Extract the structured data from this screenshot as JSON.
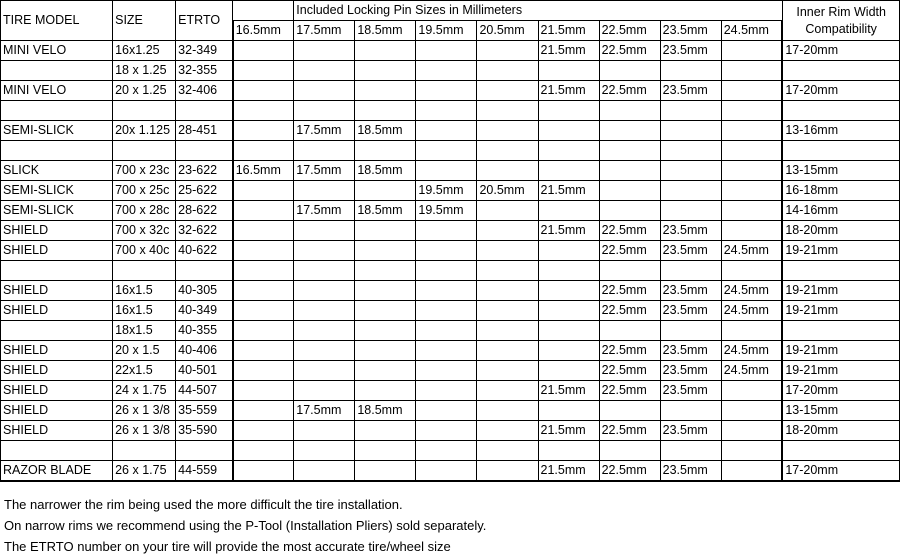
{
  "header": {
    "col_model": "TIRE MODEL",
    "col_size": "SIZE",
    "col_etrto": "ETRTO",
    "pin_group_title": "Included Locking Pin Sizes in Millimeters",
    "rim_title_line1": "Inner Rim Width",
    "rim_title_line2": "Compatibility",
    "pins": [
      {
        "label": "16.5mm",
        "color": "#ff0000",
        "class": "pc-red"
      },
      {
        "label": "17.5mm",
        "color": "#ffbf00",
        "class": "pc-orange"
      },
      {
        "label": "18.5mm",
        "color": "#ffff00",
        "class": "pc-yellow"
      },
      {
        "label": "19.5mm",
        "color": "#00b0f0",
        "class": "pc-ltblue"
      },
      {
        "label": "20.5mm",
        "color": "#92d050",
        "class": "pc-green"
      },
      {
        "label": "21.5mm",
        "color": "#7030a0",
        "class": "pc-purple"
      },
      {
        "label": "22.5mm",
        "color": "#0070c0",
        "class": "pc-blue"
      },
      {
        "label": "23.5mm",
        "color": "#ff0000",
        "class": "pc-red"
      },
      {
        "label": "24.5mm",
        "color": "#92d050",
        "class": "pc-green"
      }
    ]
  },
  "rows": [
    {
      "model": "MINI VELO",
      "size": "16x1.25",
      "etrto": "32-349",
      "shade": "sh-1",
      "rim": "17-20mm",
      "rim_shade": "sh-1",
      "pins": [
        "",
        "",
        "",
        "",
        "",
        "21.5mm",
        "22.5mm",
        "23.5mm",
        ""
      ],
      "section_top": true
    },
    {
      "model": "",
      "size": "18 x 1.25",
      "etrto": "32-355",
      "shade": "sh-1",
      "rim": "",
      "rim_shade": "sh-1",
      "pins": [
        "",
        "",
        "",
        "",
        "",
        "",
        "",
        "",
        ""
      ]
    },
    {
      "model": "MINI VELO",
      "size": "20 x 1.25",
      "etrto": "32-406",
      "shade": "sh-2",
      "rim": "17-20mm",
      "rim_shade": "sh-2",
      "pins": [
        "",
        "",
        "",
        "",
        "",
        "21.5mm",
        "22.5mm",
        "23.5mm",
        ""
      ],
      "section_bottom": true
    },
    {
      "model": "",
      "size": "",
      "etrto": "",
      "shade": "sh-none",
      "rim": "",
      "rim_shade": "sh-none",
      "pins": [
        "",
        "",
        "",
        "",
        "",
        "",
        "",
        "",
        ""
      ],
      "spacer": true
    },
    {
      "model": "SEMI-SLICK",
      "size": "20x 1.125",
      "etrto": "28-451",
      "shade": "sh-2",
      "rim": "13-16mm",
      "rim_shade": "sh-3",
      "pins": [
        "",
        "17.5mm",
        "18.5mm",
        "",
        "",
        "",
        "",
        "",
        ""
      ],
      "section_top": true,
      "section_bottom": true
    },
    {
      "model": "",
      "size": "",
      "etrto": "",
      "shade": "sh-none",
      "rim": "",
      "rim_shade": "sh-none",
      "pins": [
        "",
        "",
        "",
        "",
        "",
        "",
        "",
        "",
        ""
      ],
      "spacer": true
    },
    {
      "model": "SLICK",
      "size": "700 x 23c",
      "etrto": "23-622",
      "shade": "sh-1",
      "rim": "13-15mm",
      "rim_shade": "sh-1",
      "pins": [
        "16.5mm",
        "17.5mm",
        "18.5mm",
        "",
        "",
        "",
        "",
        "",
        ""
      ],
      "section_top": true
    },
    {
      "model": "SEMI-SLICK",
      "size": "700 x 25c",
      "etrto": "25-622",
      "shade": "sh-2",
      "rim": "16-18mm",
      "rim_shade": "sh-2",
      "pins": [
        "",
        "",
        "",
        "19.5mm",
        "20.5mm",
        "21.5mm",
        "",
        "",
        ""
      ]
    },
    {
      "model": "SEMI-SLICK",
      "size": "700 x 28c",
      "etrto": "28-622",
      "shade": "sh-3",
      "rim": "14-16mm",
      "rim_shade": "sh-3",
      "pins": [
        "",
        "17.5mm",
        "18.5mm",
        "19.5mm",
        "",
        "",
        "",
        "",
        ""
      ]
    },
    {
      "model": "SHIELD",
      "size": "700 x 32c",
      "etrto": "32-622",
      "shade": "sh-1",
      "rim": "18-20mm",
      "rim_shade": "sh-1",
      "pins": [
        "",
        "",
        "",
        "",
        "",
        "21.5mm",
        "22.5mm",
        "23.5mm",
        ""
      ]
    },
    {
      "model": "SHIELD",
      "size": "700 x 40c",
      "etrto": "40-622",
      "shade": "sh-2",
      "rim": "19-21mm",
      "rim_shade": "sh-2",
      "pins": [
        "",
        "",
        "",
        "",
        "",
        "",
        "22.5mm",
        "23.5mm",
        "24.5mm"
      ],
      "section_bottom": true
    },
    {
      "model": "",
      "size": "",
      "etrto": "",
      "shade": "sh-none",
      "rim": "",
      "rim_shade": "sh-none",
      "pins": [
        "",
        "",
        "",
        "",
        "",
        "",
        "",
        "",
        ""
      ],
      "spacer": true
    },
    {
      "model": "SHIELD",
      "size": "16x1.5",
      "etrto": "40-305",
      "shade": "sh-1",
      "rim": "19-21mm",
      "rim_shade": "sh-1",
      "pins": [
        "",
        "",
        "",
        "",
        "",
        "",
        "22.5mm",
        "23.5mm",
        "24.5mm"
      ],
      "section_top": true
    },
    {
      "model": "SHIELD",
      "size": "16x1.5",
      "etrto": "40-349",
      "shade": "sh-3",
      "rim": "19-21mm",
      "rim_shade": "sh-3",
      "pins": [
        "",
        "",
        "",
        "",
        "",
        "",
        "22.5mm",
        "23.5mm",
        "24.5mm"
      ]
    },
    {
      "model": "",
      "size": "18x1.5",
      "etrto": "40-355",
      "shade": "sh-3",
      "rim": "",
      "rim_shade": "sh-3",
      "pins": [
        "",
        "",
        "",
        "",
        "",
        "",
        "",
        "",
        ""
      ],
      "section_bottom": true
    },
    {
      "model": "SHIELD",
      "size": "20 x 1.5",
      "etrto": "40-406",
      "shade": "sh-2",
      "rim": "19-21mm",
      "rim_shade": "sh-2",
      "pins": [
        "",
        "",
        "",
        "",
        "",
        "",
        "22.5mm",
        "23.5mm",
        "24.5mm"
      ],
      "section_top": true
    },
    {
      "model": "SHIELD",
      "size": "22x1.5",
      "etrto": "40-501",
      "shade": "sh-1",
      "rim": "19-21mm",
      "rim_shade": "sh-1",
      "pins": [
        "",
        "",
        "",
        "",
        "",
        "",
        "22.5mm",
        "23.5mm",
        "24.5mm"
      ]
    },
    {
      "model": "SHIELD",
      "size": "24 x 1.75",
      "etrto": "44-507",
      "shade": "sh-3",
      "rim": "17-20mm",
      "rim_shade": "sh-2",
      "pins": [
        "",
        "",
        "",
        "",
        "",
        "21.5mm",
        "22.5mm",
        "23.5mm",
        ""
      ]
    },
    {
      "model": "SHIELD",
      "size": "26 x 1 3/8",
      "etrto": "35-559",
      "shade": "sh-1",
      "rim": "13-15mm",
      "rim_shade": "sh-1",
      "pins": [
        "",
        "17.5mm",
        "18.5mm",
        "",
        "",
        "",
        "",
        "",
        ""
      ]
    },
    {
      "model": "SHIELD",
      "size": "26 x 1 3/8",
      "etrto": "35-590",
      "shade": "sh-2",
      "rim": "18-20mm",
      "rim_shade": "sh-2",
      "pins": [
        "",
        "",
        "",
        "",
        "",
        "21.5mm",
        "22.5mm",
        "23.5mm",
        ""
      ],
      "section_bottom": true
    },
    {
      "model": "",
      "size": "",
      "etrto": "",
      "shade": "sh-none",
      "rim": "",
      "rim_shade": "sh-2",
      "pins": [
        "",
        "",
        "",
        "",
        "",
        "",
        "",
        "",
        ""
      ],
      "spacer": true
    },
    {
      "model": "RAZOR BLADE",
      "size": "26 x 1.75",
      "etrto": "44-559",
      "shade": "sh-2",
      "rim": "17-20mm",
      "rim_shade": "sh-3",
      "pins": [
        "",
        "",
        "",
        "",
        "",
        "21.5mm",
        "22.5mm",
        "23.5mm",
        ""
      ],
      "section_top": true,
      "section_bottom": true
    }
  ],
  "notes": [
    "The narrower the rim being used the more difficult the tire installation.",
    " On narrow rims we recommend using the P-Tool (Installation Pliers) sold separately.",
    "The ETRTO number on your tire will provide the most accurate tire/wheel size"
  ]
}
